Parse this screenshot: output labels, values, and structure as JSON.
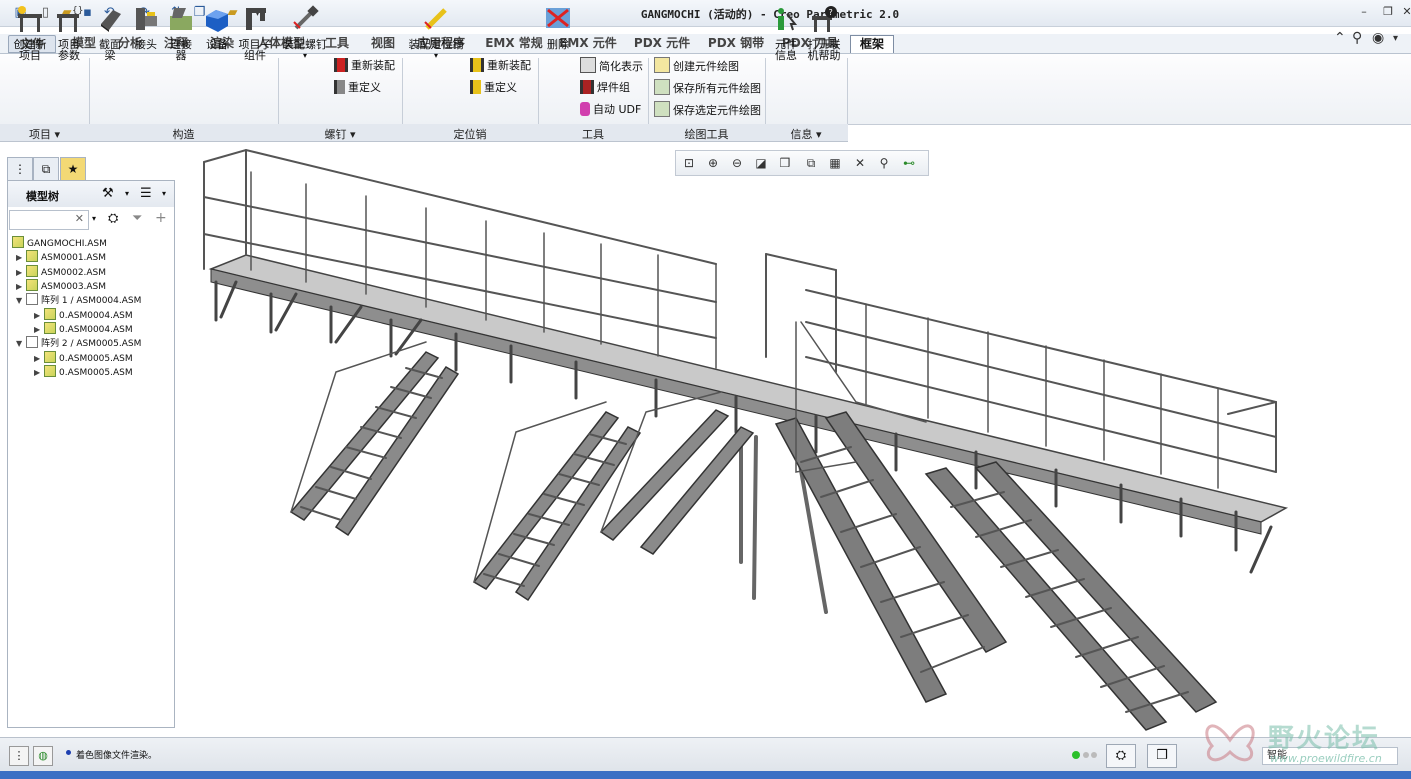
{
  "window": {
    "title": "GANGMOCHI (活动的) - Creo Parametric 2.0"
  },
  "tabs": [
    {
      "label": "文件"
    },
    {
      "label": "模型"
    },
    {
      "label": "分析"
    },
    {
      "label": "注释"
    },
    {
      "label": "渲染"
    },
    {
      "label": "人体模型"
    },
    {
      "label": "工具"
    },
    {
      "label": "视图"
    },
    {
      "label": "应用程序"
    },
    {
      "label": "EMX 常规"
    },
    {
      "label": "EMX 元件"
    },
    {
      "label": "PDX 元件"
    },
    {
      "label": "PDX 钢带"
    },
    {
      "label": "PDX 刀具"
    },
    {
      "label": "框架"
    }
  ],
  "ribbon": {
    "create_new_item": "创建新项目",
    "create_new_item_l1": "创建新",
    "create_new_item_l2": "项目",
    "item_params_l1": "项目",
    "item_params_l2": "参数",
    "section_beam_l1": "截面",
    "section_beam_l2": "梁",
    "joint": "接头",
    "connector_l1": "连接",
    "connector_l2": "器",
    "equipment": "设备",
    "item_subasm_l1": "项目子",
    "item_subasm_l2": "组件",
    "assemble_screw": "装配螺钉",
    "reassemble": "重新装配",
    "redefine": "重定义",
    "assemble_dowel": "装配定位销",
    "reassemble2": "重新装配",
    "redefine2": "重定义",
    "delete": "删除",
    "simplified_rep": "简化表示",
    "weld_group": "焊件组",
    "auto_udf": "自动 UDF",
    "create_drawing": "创建元件绘图",
    "save_all_drawings": "保存所有元件绘图",
    "save_selected_drawings": "保存选定元件绘图",
    "component_info_l1": "元件",
    "component_info_l2": "信息",
    "online_help_l1": "打开联",
    "online_help_l2": "机帮助",
    "groups": {
      "items": "项目",
      "construction": "构造",
      "screws": "螺钉",
      "dowels": "定位销",
      "tools": "工具",
      "drawing_tools": "绘图工具",
      "info": "信息"
    }
  },
  "model_tree": {
    "title": "模型树",
    "rows": [
      {
        "label": "GANGMOCHI.ASM"
      },
      {
        "label": "ASM0001.ASM"
      },
      {
        "label": "ASM0002.ASM"
      },
      {
        "label": "ASM0003.ASM"
      },
      {
        "label": "阵列 1 / ASM0004.ASM"
      },
      {
        "label": "0.ASM0004.ASM"
      },
      {
        "label": "0.ASM0004.ASM"
      },
      {
        "label": "阵列 2 / ASM0005.ASM"
      },
      {
        "label": "0.ASM0005.ASM"
      },
      {
        "label": "0.ASM0005.ASM"
      }
    ]
  },
  "status": {
    "message": "着色图像文件渲染。",
    "selection_filter": "智能"
  },
  "watermark": {
    "name": "野火论坛",
    "url": "www.proewildfire.cn"
  }
}
